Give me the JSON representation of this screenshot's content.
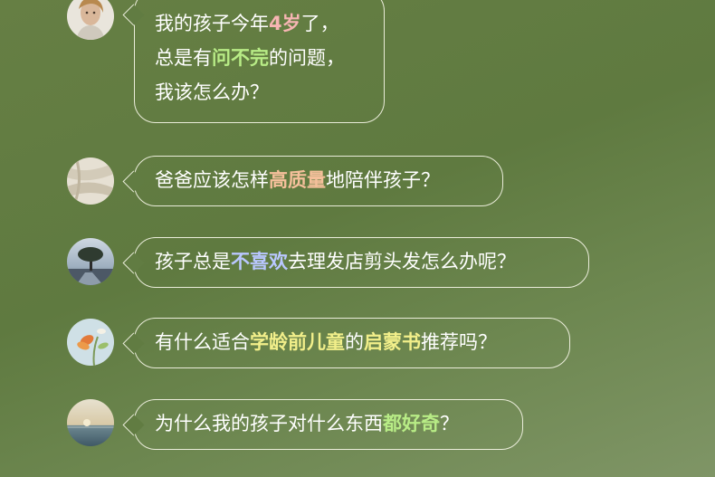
{
  "colors": {
    "background": "#617c42",
    "bubble_border": "#f5f5e6",
    "text": "#ffffff",
    "highlight_pink": "#f7b5b3",
    "highlight_green": "#b8ec86",
    "highlight_peach": "#f5c09b",
    "highlight_blue": "#b9c7ff",
    "highlight_yellow": "#f2ef8a"
  },
  "messages": [
    {
      "avatar": "portrait-avatar",
      "lines": [
        {
          "a": "我的孩子今年",
          "b": "4岁",
          "c": "了，"
        },
        {
          "a": "总是有",
          "b": "问不完",
          "c": "的问题，"
        },
        {
          "a": "我该怎么办？"
        }
      ]
    },
    {
      "avatar": "fabric-avatar",
      "a": "爸爸应该怎样",
      "b": "高质量",
      "c": "地陪伴孩子？"
    },
    {
      "avatar": "tree-avatar",
      "a": "孩子总是",
      "b": "不喜欢",
      "c": "去理发店剪头发怎么办呢？"
    },
    {
      "avatar": "flower-avatar",
      "a": "有什么适合",
      "b": "学龄前儿童",
      "c": "的",
      "d": "启蒙书",
      "e": "推荐吗？"
    },
    {
      "avatar": "sea-avatar",
      "a": "为什么我的孩子对什么东西",
      "b": "都好奇",
      "c": "？"
    }
  ]
}
